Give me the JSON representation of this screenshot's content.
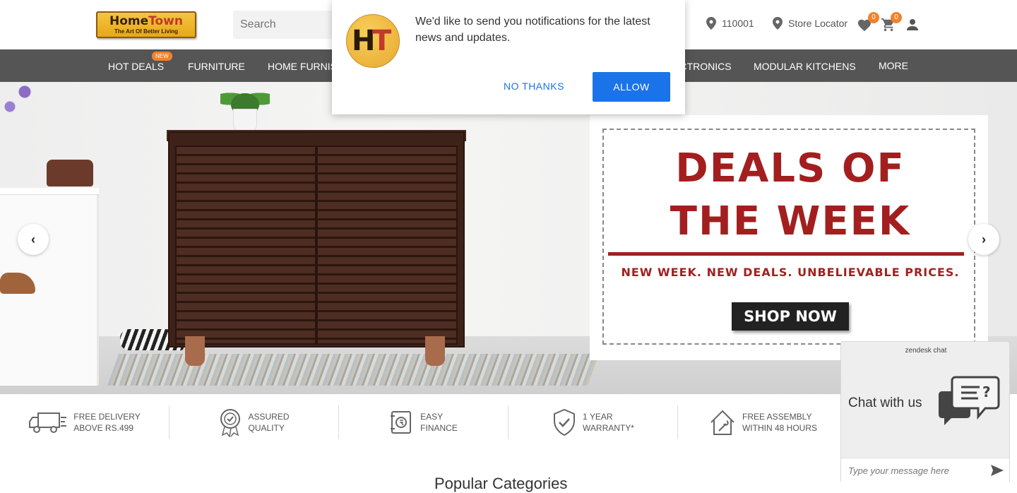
{
  "header": {
    "logo_brand_a": "Home",
    "logo_brand_b": "Town",
    "logo_tagline": "The Art Of Better Living",
    "search_placeholder": "Search",
    "pincode": "110001",
    "store_locator": "Store Locator",
    "wishlist_count": "0",
    "cart_count": "0"
  },
  "nav": {
    "items": [
      "HOT DEALS",
      "FURNITURE",
      "HOME FURNISHING",
      "ELECTRONICS",
      "MODULAR KITCHENS",
      "MORE"
    ],
    "new_badge": "NEW"
  },
  "notification": {
    "icon_h": "H",
    "icon_t": "T",
    "message": "We'd like to send you notifications for the latest news and updates.",
    "no_thanks": "NO THANKS",
    "allow": "ALLOW"
  },
  "hero": {
    "title_line1": "DEALS OF",
    "title_line2": "THE WEEK",
    "subtitle": "NEW WEEK. NEW DEALS. UNBELIEVABLE PRICES.",
    "cta": "SHOP NOW"
  },
  "usps": [
    {
      "line1": "FREE DELIVERY",
      "line2": "ABOVE RS.499",
      "icon": "truck-icon"
    },
    {
      "line1": "ASSURED",
      "line2": "QUALITY",
      "icon": "quality-badge-icon"
    },
    {
      "line1": "EASY",
      "line2": "FINANCE",
      "icon": "finance-icon"
    },
    {
      "line1": "1 YEAR",
      "line2": "WARRANTY*",
      "icon": "shield-check-icon"
    },
    {
      "line1": "FREE ASSEMBLY",
      "line2": "WITHIN 48 HOURS",
      "icon": "house-tools-icon"
    }
  ],
  "below": {
    "heading": "Popular Categories"
  },
  "chat": {
    "brand": "zendesk chat",
    "label": "Chat with us",
    "input_placeholder": "Type your message here"
  },
  "colors": {
    "brand_red": "#a31f1f",
    "nav_bg": "#555555",
    "accent_orange": "#f0822d",
    "allow_blue": "#1a73e8"
  }
}
